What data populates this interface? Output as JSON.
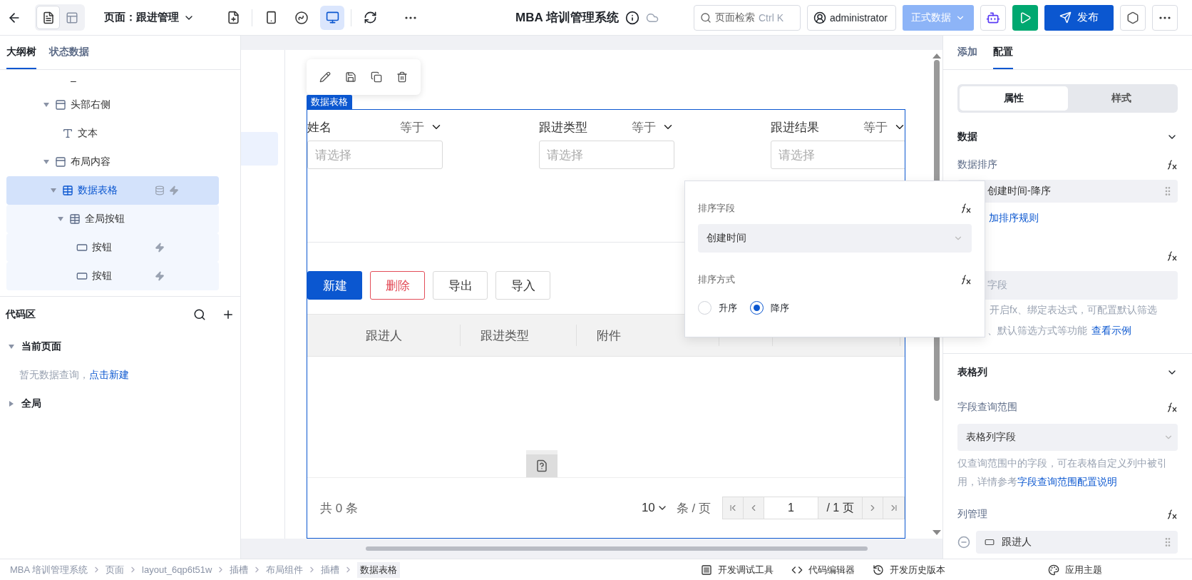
{
  "topbar": {
    "view_modes": [
      {
        "kind": "outline",
        "selected": true
      },
      {
        "kind": "layout",
        "selected": false
      }
    ],
    "page_title": "页面：跟进管理",
    "devices": [
      {
        "kind": "mobile",
        "selected": false
      },
      {
        "kind": "miniapp",
        "selected": false
      },
      {
        "kind": "desktop",
        "selected": true
      }
    ],
    "app_title": "MBA 培训管理系统",
    "search": {
      "placeholder": "页面检索",
      "shortcut": "Ctrl K"
    },
    "user": "administrator",
    "env": "正式数据",
    "publish": "发布"
  },
  "left_panel": {
    "tabs": [
      {
        "label": "大纲树",
        "selected": true
      },
      {
        "label": "状态数据",
        "selected": false
      }
    ],
    "tree": [
      {
        "kind": "dash",
        "label": "–",
        "selected": false
      },
      {
        "kind": "layout",
        "label": "头部右侧",
        "selected": false,
        "expanded": true,
        "children": [
          {
            "kind": "text",
            "label": "文本",
            "selected": false
          }
        ]
      },
      {
        "kind": "layout",
        "label": "布局内容",
        "selected": false,
        "expanded": true,
        "children": [
          {
            "kind": "table",
            "label": "数据表格",
            "selected": true,
            "expanded": true,
            "bound_data": true,
            "has_action": true,
            "children": [
              {
                "kind": "table",
                "label": "全局按钮",
                "selected": false,
                "expanded": true,
                "children": [
                  {
                    "kind": "button",
                    "label": "按钮",
                    "selected": false,
                    "has_action": true
                  },
                  {
                    "kind": "button",
                    "label": "按钮",
                    "selected": false,
                    "has_action": true
                  }
                ]
              }
            ]
          }
        ]
      }
    ],
    "code_area": {
      "title": "代码区",
      "groups": [
        {
          "label": "当前页面",
          "expanded": true,
          "empty_text": "暂无数据查询，",
          "empty_link": "点击新建"
        },
        {
          "label": "全局",
          "expanded": false
        }
      ]
    }
  },
  "canvas": {
    "tag": "数据表格",
    "filters": [
      {
        "label": "姓名",
        "operator": "等于",
        "placeholder": "请选择"
      },
      {
        "label": "跟进类型",
        "operator": "等于",
        "placeholder": "请选择"
      },
      {
        "label": "跟进结果",
        "operator": "等于",
        "placeholder": "请选择"
      }
    ],
    "buttons": [
      {
        "label": "新建",
        "kind": "primary"
      },
      {
        "label": "删除",
        "kind": "danger"
      },
      {
        "label": "导出",
        "kind": "default"
      },
      {
        "label": "导入",
        "kind": "default"
      }
    ],
    "columns": [
      "跟进人",
      "跟进类型",
      "附件"
    ],
    "pagination": {
      "total": "共 0 条",
      "page_size": "10",
      "per_page": "条 / 页",
      "page": "1",
      "pages": "/ 1 页"
    }
  },
  "sort_popover": {
    "field_label": "排序字段",
    "field_value": "创建时间",
    "order_label": "排序方式",
    "options": [
      {
        "label": "升序",
        "selected": false
      },
      {
        "label": "降序",
        "selected": true
      }
    ]
  },
  "right_panel": {
    "tabs": [
      {
        "label": "添加",
        "selected": false
      },
      {
        "label": "配置",
        "selected": true
      }
    ],
    "segments": [
      {
        "label": "属性",
        "selected": true
      },
      {
        "label": "样式",
        "selected": false
      }
    ],
    "data_section": {
      "title": "数据",
      "sort_label": "数据排序",
      "sort_rule": "创建时间-降序",
      "add_rule": "加排序规则",
      "filter_placeholder": "字段",
      "help_line1": "开启fx、绑定表达式，可配置默认筛选",
      "help_line2": "、默认筛选方式等功能",
      "help_link": "查看示例"
    },
    "columns_section": {
      "title": "表格列",
      "scope_label": "字段查询范围",
      "scope_value": "表格列字段",
      "help": "仅查询范围中的字段，可在表格自定义列中被引用，详情参考",
      "help_link": "字段查询范围配置说明",
      "manage_label": "列管理",
      "column_item": "跟进人"
    }
  },
  "status_bar": {
    "breadcrumbs": [
      "MBA 培训管理系统",
      "页面",
      "layout_6qp6t51w",
      "插槽",
      "布局组件",
      "插槽",
      "数据表格"
    ],
    "tools": [
      {
        "kind": "debug",
        "label": "开发调试工具"
      },
      {
        "kind": "code",
        "label": "代码编辑器"
      },
      {
        "kind": "history",
        "label": "开发历史版本"
      }
    ],
    "theme": "应用主题"
  }
}
